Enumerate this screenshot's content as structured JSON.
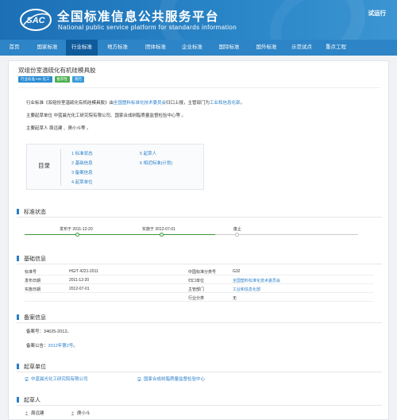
{
  "header": {
    "logo_text": "SAC",
    "title_cn": "全国标准信息公共服务平台",
    "title_en": "National public service platform for standards information",
    "trial": "试运行"
  },
  "nav": [
    {
      "label": "首页"
    },
    {
      "label": "国家标准"
    },
    {
      "label": "行业标准",
      "active": true
    },
    {
      "label": "地方标准"
    },
    {
      "label": "团体标准"
    },
    {
      "label": "企业标准"
    },
    {
      "label": "国际标准"
    },
    {
      "label": "国外标准"
    },
    {
      "label": "示范试点"
    },
    {
      "label": "重点工程"
    }
  ],
  "standard": {
    "title": "双组份室温硫化有机硅模具胶",
    "badges": [
      "行业标准-HG 化工",
      "推荐性",
      "现行"
    ],
    "intro": {
      "line1_pre": "行业标准《双组份室温硫化有机硅模具胶》由",
      "line1_link1": "全国塑料标准化技术委员会",
      "line1_mid": "归口上报，主管部门为",
      "line1_link2": "工业和信息化部",
      "line1_post": "。",
      "line2": "主要起草单位 中蓝晨光化工研究院有限公司、国家合成树脂质量监督检验中心等 。",
      "line3": "主要起草人 周远建 、庚小斗等 。"
    }
  },
  "toc": {
    "label": "目录",
    "items": [
      "1 标准状态",
      "2 基础信息",
      "3 备案信息",
      "4 起草单位",
      "5 起草人",
      "6 相近标准(计划)"
    ]
  },
  "status": {
    "heading": "标准状态",
    "publish": "发布于 2011-12-20",
    "implement": "实施于 2012-07-01",
    "abolish": "废止"
  },
  "basic": {
    "heading": "基础信息",
    "rows": [
      {
        "k1": "标准号",
        "v1": "HG/T 4221-2011",
        "k2": "中国标准分类号",
        "v2": "G32"
      },
      {
        "k1": "发布日期",
        "v1": "2011-12-20",
        "k2": "归口单位",
        "v2": "全国塑料标准化技术委员会",
        "link2": true
      },
      {
        "k1": "实施日期",
        "v1": "2012-07-01",
        "k2": "主管部门",
        "v2": "工业和信息化部",
        "link2": true
      },
      {
        "k1": "",
        "v1": "",
        "k2": "行业分类",
        "v2": "无"
      }
    ]
  },
  "record": {
    "heading": "备案信息",
    "number_label": "备案号：",
    "number": "34625-2012",
    "number_post": "。",
    "notice_label": "备案公告：",
    "notice": "2012年第2号",
    "notice_post": "。"
  },
  "drafters_org": {
    "heading": "起草单位",
    "items": [
      "中蓝晨光化工研究院有限公司",
      "国家合成树脂质量监督检验中心"
    ]
  },
  "drafters": {
    "heading": "起草人",
    "items": [
      "周远建",
      "庚小斗"
    ]
  },
  "colors": {
    "accent": "#2a7fc9",
    "nav": "#2d84c6",
    "nav_active": "#0e5a9b",
    "timeline_done": "#3a9b3f"
  }
}
